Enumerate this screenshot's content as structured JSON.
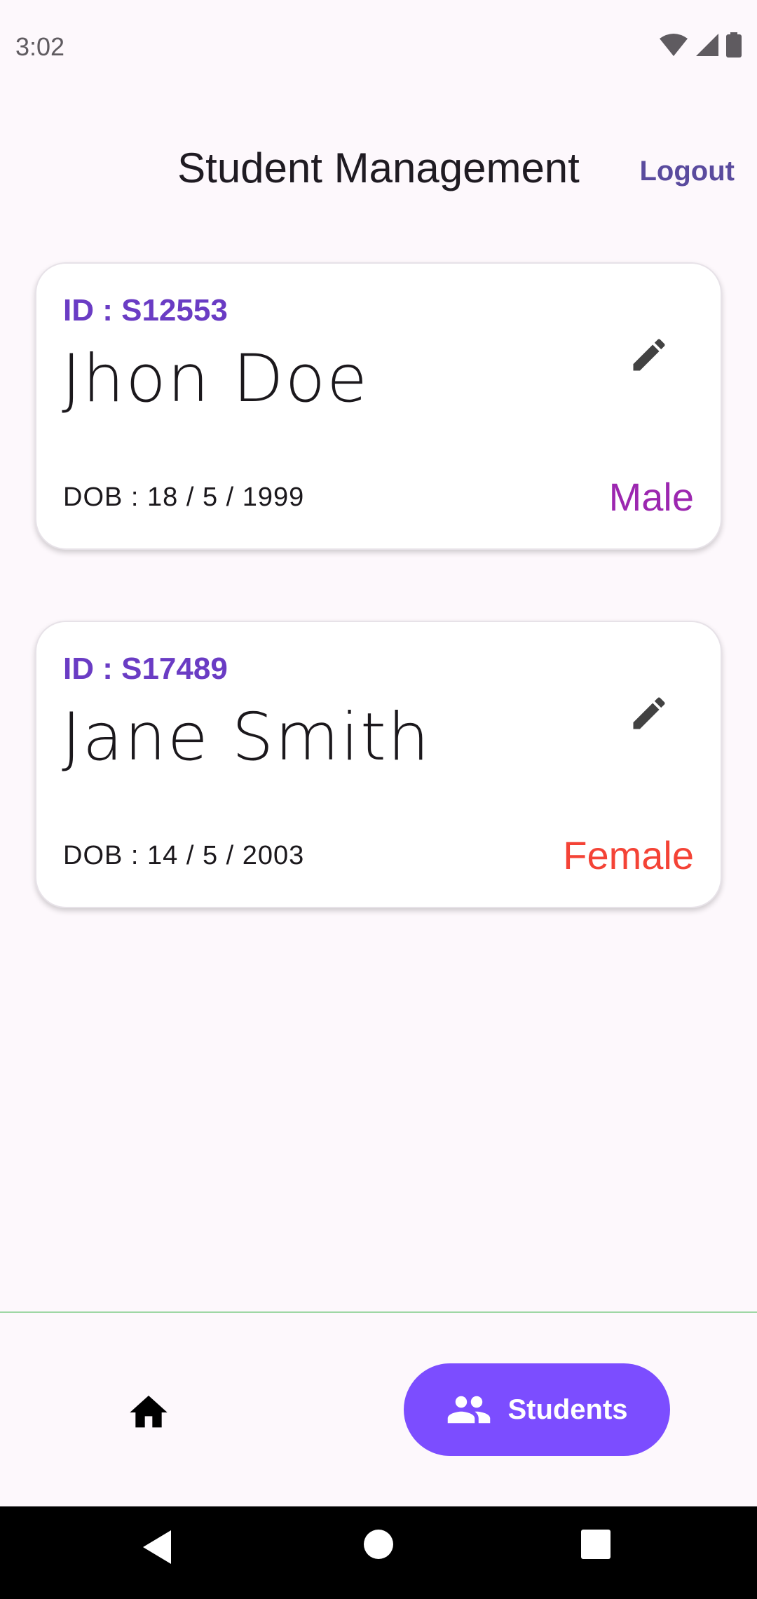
{
  "status_bar": {
    "time": "3:02"
  },
  "header": {
    "title": "Student Management",
    "logout_label": "Logout"
  },
  "students": [
    {
      "id_text": "ID : S12553",
      "name": "Jhon Doe",
      "dob_text": "DOB : 18 / 5 / 1999",
      "gender": "Male",
      "gender_color": "#9c27b0"
    },
    {
      "id_text": "ID : S17489",
      "name": "Jane Smith",
      "dob_text": "DOB : 14 / 5 / 2003",
      "gender": "Female",
      "gender_color": "#f44336"
    }
  ],
  "bottom_nav": {
    "items": [
      {
        "icon": "home-icon",
        "label": ""
      },
      {
        "icon": "people-icon",
        "label": "Students",
        "selected": true
      }
    ],
    "accent_color": "#7c4dff"
  },
  "icons": {
    "edit": "pencil-icon",
    "system_back": "back-triangle-icon",
    "system_home": "home-circle-icon",
    "system_recents": "recents-square-icon"
  }
}
